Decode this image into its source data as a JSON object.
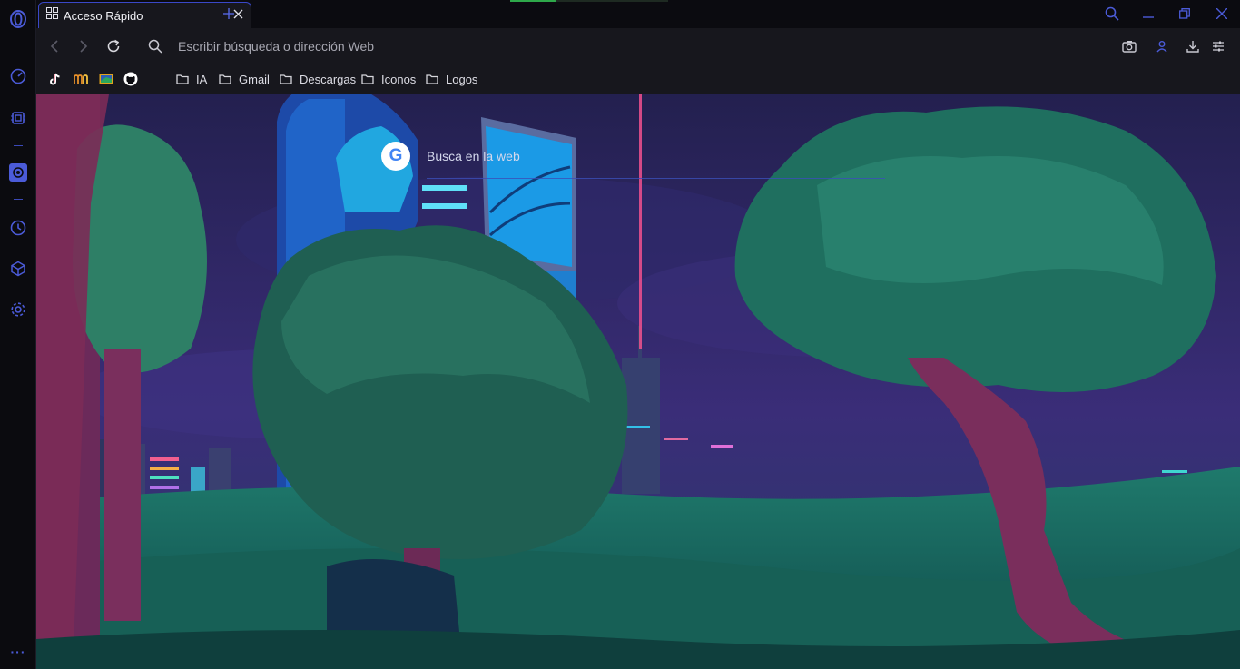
{
  "tab": {
    "title": "Acceso Rápido"
  },
  "address_bar": {
    "placeholder": "Escribir búsqueda o dirección Web"
  },
  "bookmarks": {
    "favicons": [
      "tiktok-icon",
      "mn-icon",
      "card-icon",
      "github-icon"
    ],
    "folders": [
      {
        "label": "IA"
      },
      {
        "label": "Gmail"
      },
      {
        "label": "Descargas"
      },
      {
        "label": "Iconos"
      },
      {
        "label": "Logos"
      }
    ]
  },
  "speed_dial": {
    "search_label": "Busca en la web",
    "search_logo": "G"
  },
  "sidebar": {
    "items": [
      "opera-logo-icon",
      "speed-dial-icon",
      "extensions-icon",
      "ai-icon",
      "history-icon",
      "cube-icon",
      "settings-icon",
      "more-icon"
    ],
    "more_label": "···"
  },
  "colors": {
    "accent": "#4b5bd8",
    "background": "#0b0b10",
    "toolbar": "#17171d"
  }
}
